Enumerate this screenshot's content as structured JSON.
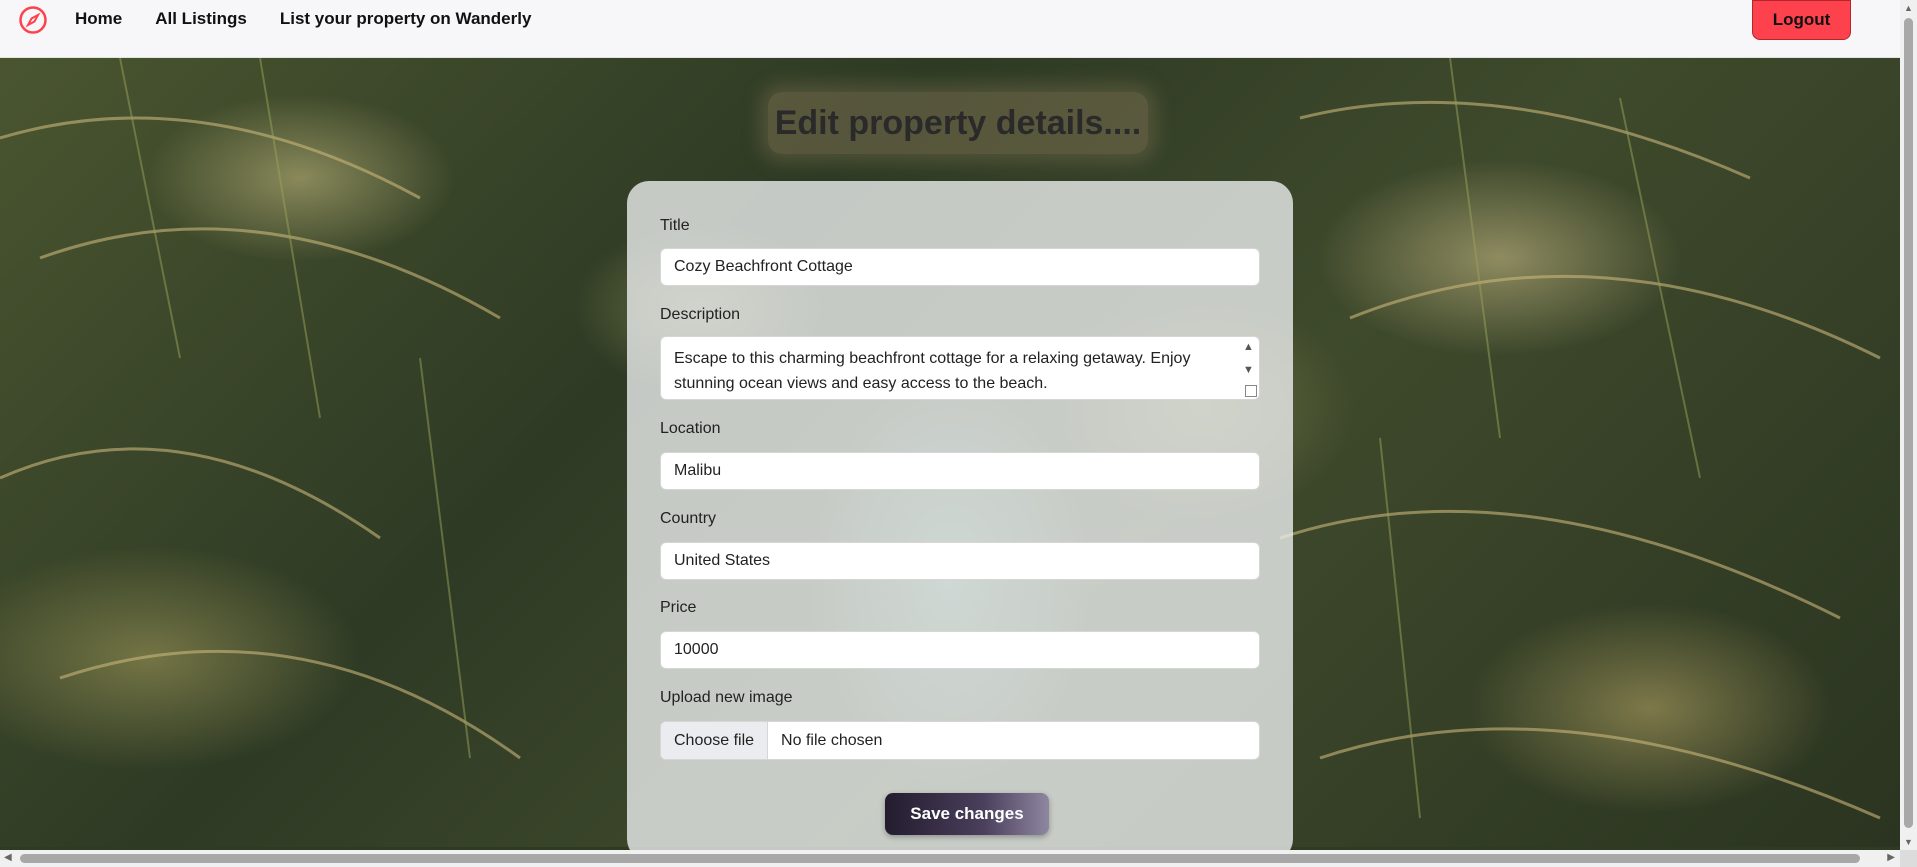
{
  "navbar": {
    "brand_icon": "compass-icon",
    "links": [
      "Home",
      "All Listings",
      "List your property on Wanderly"
    ],
    "logout_label": "Logout"
  },
  "page": {
    "title": "Edit property details...."
  },
  "form": {
    "title_label": "Title",
    "title_value": "Cozy Beachfront Cottage",
    "description_label": "Description",
    "description_value": "Escape to this charming beachfront cottage for a relaxing getaway. Enjoy stunning ocean views and easy access to the beach.",
    "location_label": "Location",
    "location_value": "Malibu",
    "country_label": "Country",
    "country_value": "United States",
    "price_label": "Price",
    "price_value": "10000",
    "image_label": "Upload new image",
    "file_button_label": "Choose file",
    "file_status": "No file chosen",
    "submit_label": "Save changes"
  },
  "colors": {
    "accent": "#fe424d",
    "button_dark": "#231c2e"
  }
}
